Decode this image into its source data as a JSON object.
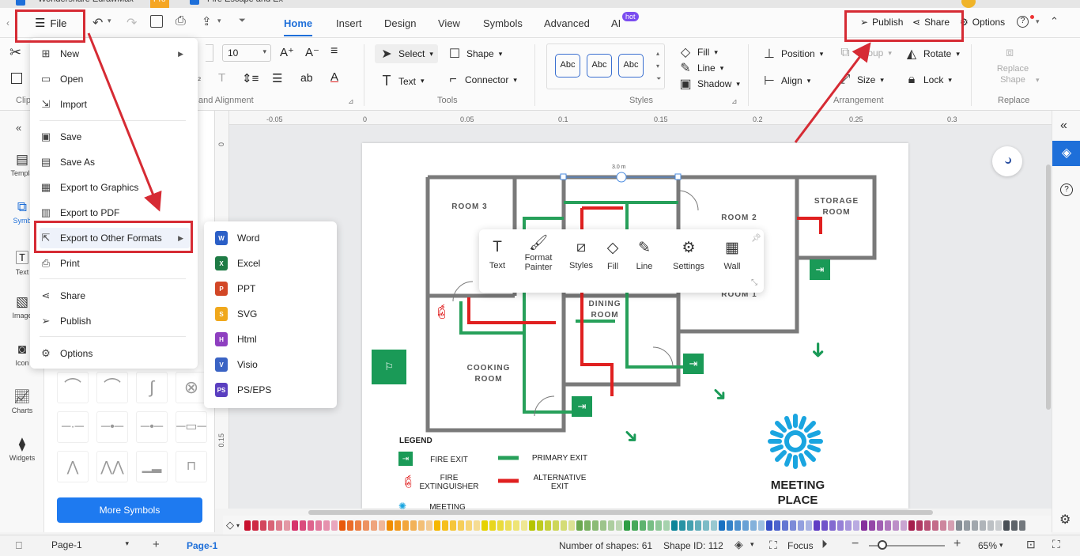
{
  "window": {
    "app_title": "Wondershare EdrawMax",
    "pro_badge": "Pro",
    "doc_tab": "Fire Escape and Ex"
  },
  "menubar": {
    "file_label": "File",
    "tabs": [
      "Home",
      "Insert",
      "Design",
      "View",
      "Symbols",
      "Advanced",
      "AI"
    ],
    "hot_badge": "hot",
    "publish_label": "Publish",
    "share_label": "Share",
    "options_label": "Options"
  },
  "ribbon": {
    "font_size": "10",
    "select_label": "Select",
    "shape_label": "Shape",
    "text_label": "Text",
    "connector_label": "Connector",
    "tools_group": "Tools",
    "style_swatches": [
      "Abc",
      "Abc",
      "Abc"
    ],
    "fill_label": "Fill",
    "line_label": "Line",
    "shadow_label": "Shadow",
    "styles_group": "Styles",
    "position_label": "Position",
    "group_label": "Group",
    "rotate_label": "Rotate",
    "align_label": "Align",
    "size_label": "Size",
    "lock_label": "Lock",
    "arrangement_group": "Arrangement",
    "replace_shape_label": "Replace Shape",
    "replace_group": "Replace",
    "font_group_partial": "and Alignment",
    "clip_group_partial": "Clip"
  },
  "leftnav": {
    "items": [
      "Templa",
      "Symb",
      "Text",
      "Image",
      "Icon",
      "Charts",
      "Widgets"
    ]
  },
  "library": {
    "more_symbols": "More Symbols"
  },
  "file_menu": {
    "items": [
      "New",
      "Open",
      "Import",
      "Save",
      "Save As",
      "Export to Graphics",
      "Export to PDF",
      "Export to Other Formats",
      "Print",
      "Share",
      "Publish",
      "Options"
    ]
  },
  "export_submenu": {
    "items": [
      {
        "label": "Word",
        "badge": "W",
        "color": "#2b5fc7"
      },
      {
        "label": "Excel",
        "badge": "X",
        "color": "#1e7b45"
      },
      {
        "label": "PPT",
        "badge": "P",
        "color": "#d24726"
      },
      {
        "label": "SVG",
        "badge": "S",
        "color": "#f0a81c"
      },
      {
        "label": "Html",
        "badge": "H",
        "color": "#8e3fc0"
      },
      {
        "label": "Visio",
        "badge": "V",
        "color": "#3a63c4"
      },
      {
        "label": "PS/EPS",
        "badge": "PS",
        "color": "#5a3fc0"
      }
    ]
  },
  "ruler": {
    "h_ticks": [
      "-0.05",
      "0",
      "0.05",
      "0.1",
      "0.15",
      "0.2",
      "0.25",
      "0.3"
    ],
    "v_ticks": [
      "0",
      "0.15"
    ]
  },
  "floating_toolbar": {
    "items": [
      "Text",
      "Format Painter",
      "Styles",
      "Fill",
      "Line",
      "Settings",
      "Wall"
    ]
  },
  "floorplan": {
    "dimension": "3.0 m",
    "rooms": [
      "ROOM 3",
      "ROOM 2",
      "STORAGE ROOM",
      "DINING ROOM",
      "ROOM 1",
      "COOKING ROOM"
    ],
    "legend_title": "LEGEND",
    "legend": [
      "FIRE EXIT",
      "FIRE EXTINGUISHER",
      "MEETING",
      "PRIMARY EXIT",
      "ALTERNATIVE EXIT"
    ],
    "meeting_place": "MEETING PLACE"
  },
  "statusbar": {
    "page_select": "Page-1",
    "page_tab": "Page-1",
    "shape_count": "Number of shapes: 61",
    "shape_id": "Shape ID: 112",
    "focus_label": "Focus",
    "zoom": "65%"
  },
  "colors": {
    "accent": "#1e6fd9",
    "highlight": "#d62b34",
    "primary_exit": "#27a05a",
    "alternative_exit": "#e02020"
  }
}
